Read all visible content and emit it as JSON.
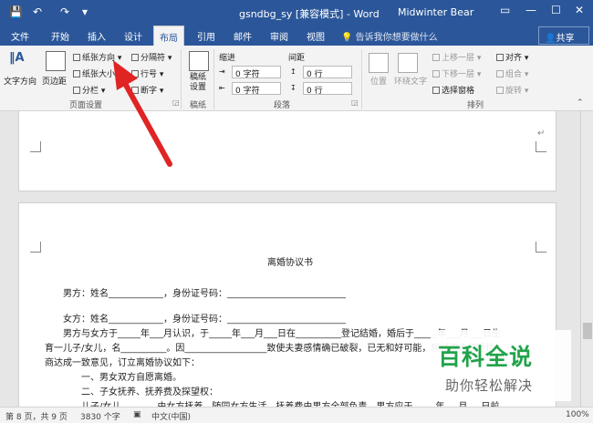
{
  "titlebar": {
    "title": "gsndbg_sy [兼容模式] - Word",
    "user": "Midwinter Bear",
    "quick_access": [
      "💾",
      "↶",
      "↷",
      "▾"
    ],
    "controls": [
      "▭",
      "—",
      "☐",
      "✕"
    ]
  },
  "tabs": [
    {
      "label": "文件"
    },
    {
      "label": "开始"
    },
    {
      "label": "插入"
    },
    {
      "label": "设计"
    },
    {
      "label": "布局"
    },
    {
      "label": "引用"
    },
    {
      "label": "邮件"
    },
    {
      "label": "审阅"
    },
    {
      "label": "视图"
    }
  ],
  "tell_me": "告诉我你想要做什么",
  "share": "共享",
  "ribbon": {
    "page_setup": {
      "text_direction": "文字方向",
      "margins": "页边距",
      "orientation": "纸张方向",
      "size": "纸张大小",
      "columns": "分栏",
      "breaks": "分隔符",
      "line_numbers": "行号",
      "hyphenation": "断字",
      "group_label": "页面设置"
    },
    "draft": {
      "button": "稿纸\n设置",
      "group_label": "稿纸"
    },
    "paragraph": {
      "indent_label": "缩进",
      "spacing_label": "间距",
      "left_value": "0 字符",
      "right_value": "0 字符",
      "before_value": "0 行",
      "after_value": "0 行",
      "group_label": "段落"
    },
    "arrange": {
      "position": "位置",
      "wrap_text": "环绕文字",
      "bring_forward": "上移一层",
      "send_backward": "下移一层",
      "selection_pane": "选择窗格",
      "align": "对齐",
      "group": "组合",
      "rotate": "旋转",
      "group_label": "排列"
    }
  },
  "document": {
    "title": "离婚协议书",
    "lines": [
      "男方：姓名____________，身份证号码：__________________________",
      "女方：姓名____________，身份证号码：__________________________",
      "男方与女方于_____年___月认识，于_____年___月___日在__________登记结婚，婚后于_____年___月___日生",
      "育一儿子/女儿，名__________。因__________________致使夫妻感情确已破裂，已无和好可能，现经双方自愿协",
      "商达成一致意见，订立离婚协议如下：",
      "一、男女双方自愿离婚。",
      "二、子女抚养、抚养费及探望权：",
      "儿子/女儿________由女方抚养，随同女方生活，抚养费由男方全部负责，男方应于_____年___月___日前"
    ]
  },
  "status": {
    "page": "第 8 页，共 9 页",
    "words": "3830 个字",
    "language": "中文(中国)",
    "zoom": "100%"
  },
  "watermark": {
    "title": "百科全说",
    "subtitle": "助你轻松解决"
  }
}
